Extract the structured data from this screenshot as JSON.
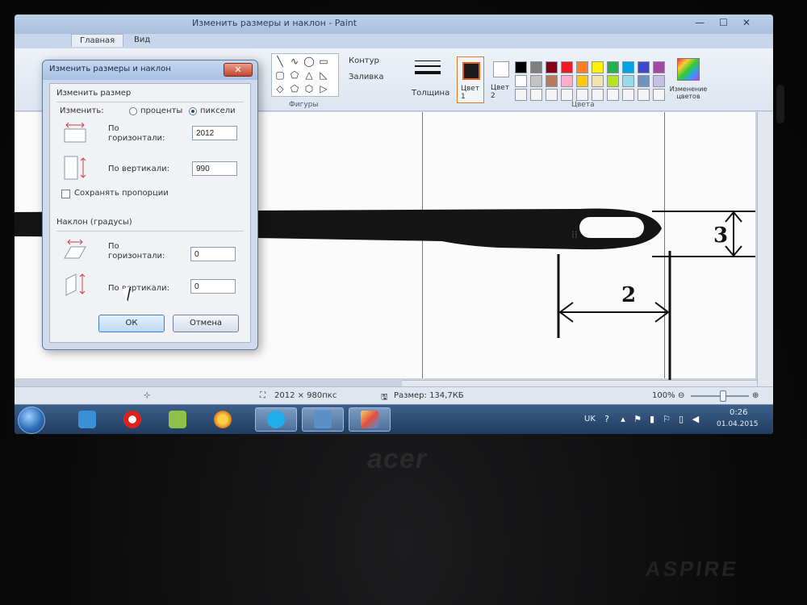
{
  "window": {
    "title": "Изменить размеры и наклон - Paint",
    "controls": [
      "—",
      "☐",
      "✕"
    ]
  },
  "ribbon": {
    "tabs": [
      "Главная",
      "Вид"
    ],
    "groups": {
      "shapes_label": "Фигуры",
      "outline_label": "Контур",
      "fill_label": "Заливка",
      "thickness_label": "Толщина",
      "color1_label": "Цвет 1",
      "color2_label": "Цвет 2",
      "colors_label": "Цвета",
      "edit_colors_label": "Изменение цветов"
    },
    "palette": [
      "#000000",
      "#7f7f7f",
      "#880015",
      "#ed1c24",
      "#ff7f27",
      "#fff200",
      "#22b14c",
      "#00a2e8",
      "#3f48cc",
      "#a349a4",
      "#ffffff",
      "#c3c3c3",
      "#b97a57",
      "#ffaec9",
      "#ffc90e",
      "#efe4b0",
      "#b5e61d",
      "#99d9ea",
      "#7092be",
      "#c8bfe7",
      "#f4f4f4",
      "#f4f4f4",
      "#f4f4f4",
      "#f4f4f4",
      "#f4f4f4",
      "#f4f4f4",
      "#f4f4f4",
      "#f4f4f4",
      "#f4f4f4",
      "#f4f4f4"
    ]
  },
  "canvas": {
    "dimension_2": "2",
    "dimension_3": "3"
  },
  "dialog": {
    "title": "Изменить размеры и наклон",
    "close": "✕",
    "resize_section": "Изменить размер",
    "by_label": "Изменить:",
    "option_percent": "проценты",
    "option_pixels": "пиксели",
    "horizontal_label": "По горизонтали:",
    "horizontal_value": "2012",
    "vertical_label": "По вертикали:",
    "vertical_value": "990",
    "keep_aspect": "Сохранять пропорции",
    "skew_section": "Наклон (градусы)",
    "skew_horizontal_label": "По горизонтали:",
    "skew_horizontal_value": "0",
    "skew_vertical_label": "По вертикали:",
    "skew_vertical_value": "0",
    "ok": "ОК",
    "cancel": "Отмена"
  },
  "statusbar": {
    "dimensions": "2012 × 980пкс",
    "size": "Размер: 134,7КБ",
    "zoom": "100%"
  },
  "taskbar": {
    "apps": [
      "start",
      "explorer",
      "opera",
      "camera",
      "media-player",
      "skype",
      "desktop",
      "paint"
    ],
    "language": "UK",
    "time": "0:26",
    "date": "01.04.2015"
  },
  "laptop": {
    "brand": "acer",
    "model": "ASPIRE"
  }
}
